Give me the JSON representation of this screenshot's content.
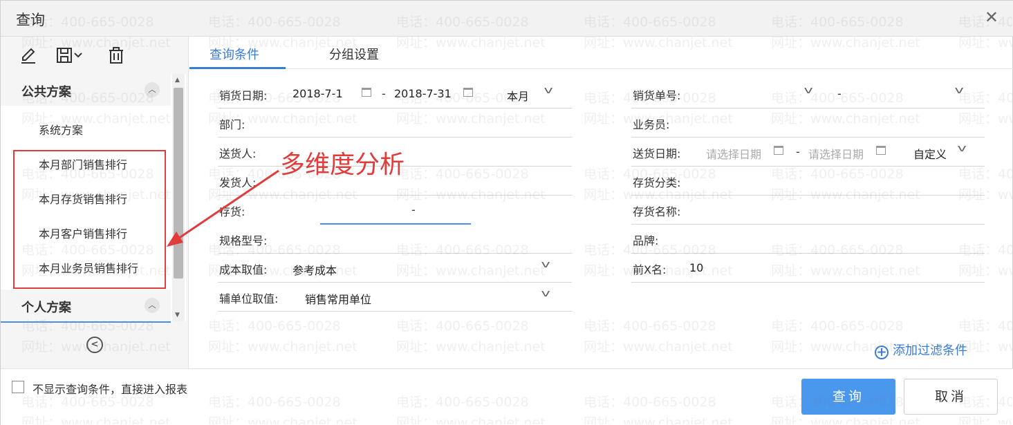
{
  "dialog": {
    "title": "查询"
  },
  "watermark": {
    "phone": "电话：400-665-0028",
    "site": "网址：www.chanjet.net"
  },
  "schemes": {
    "public_title": "公共方案",
    "personal_title": "个人方案",
    "items": [
      "系统方案",
      "本月部门销售排行",
      "本月存货销售排行",
      "本月客户销售排行",
      "本月业务员销售排行"
    ]
  },
  "tabs": [
    "查询条件",
    "分组设置"
  ],
  "fields": {
    "sale_date": {
      "label": "销货日期:",
      "start": "2018-7-1",
      "sep": "-",
      "end": "2018-7-31",
      "period": "本月"
    },
    "sale_no": {
      "label": "销货单号:",
      "sep": "-"
    },
    "dept": {
      "label": "部门:"
    },
    "salesman": {
      "label": "业务员:"
    },
    "deliverer": {
      "label": "送货人:"
    },
    "delivery_date": {
      "label": "送货日期:",
      "start_placeholder": "请选择日期",
      "sep": "-",
      "end_placeholder": "请选择日期",
      "period": "自定义"
    },
    "shipper": {
      "label": "发货人:"
    },
    "inventory_class": {
      "label": "存货分类:"
    },
    "inventory": {
      "label": "存货:",
      "sep": "-"
    },
    "inventory_name": {
      "label": "存货名称:"
    },
    "spec": {
      "label": "规格型号:"
    },
    "brand": {
      "label": "品牌:"
    },
    "cost": {
      "label": "成本取值:",
      "value": "参考成本"
    },
    "top_x": {
      "label": "前X名:",
      "value": "10"
    },
    "aux_unit": {
      "label": "辅单位取值:",
      "value": "销售常用单位"
    }
  },
  "annotation": {
    "text": "多维度分析",
    "color": "#e23b3b"
  },
  "add_filter": {
    "label": "添加过滤条件"
  },
  "footer": {
    "skip_label": "不显示查询条件，直接进入报表",
    "query_label": "查询",
    "cancel_label": "取消"
  },
  "colors": {
    "accent": "#3a7bd5",
    "primary_button": "#4a97ee",
    "annotation": "#e23b3b"
  }
}
